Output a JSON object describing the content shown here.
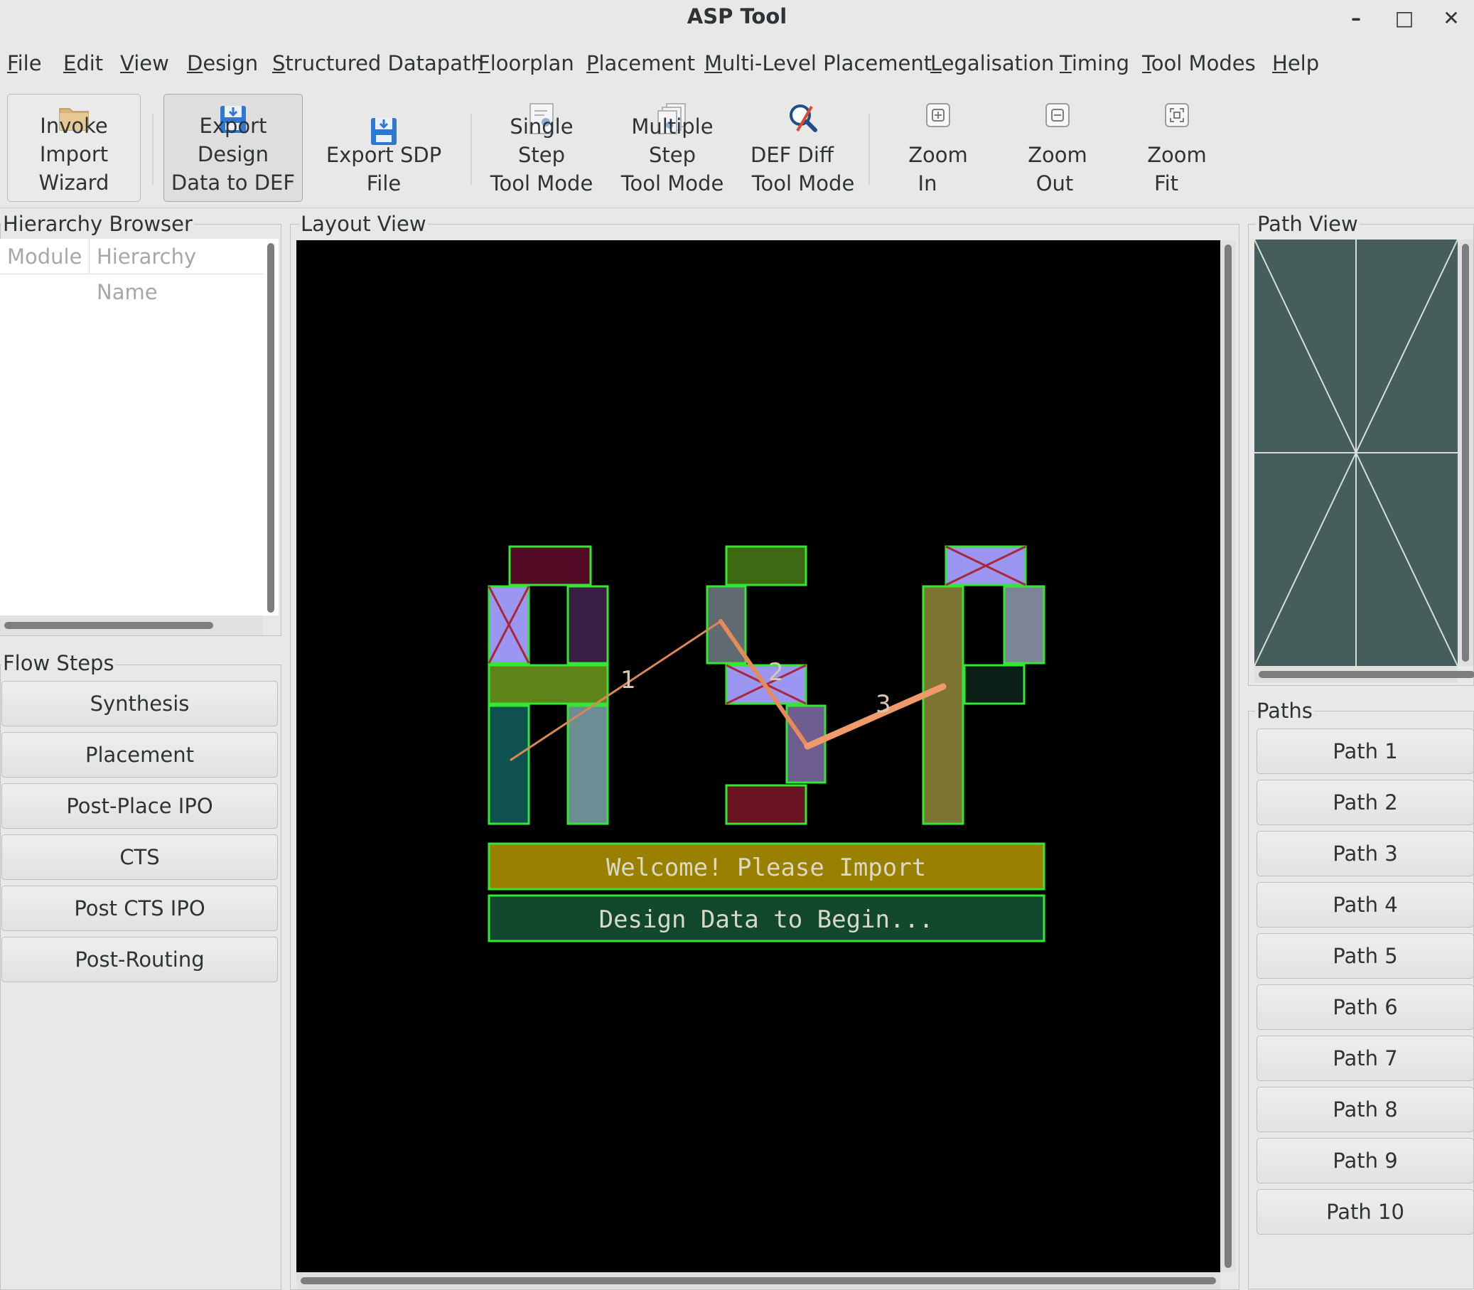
{
  "window": {
    "title": "ASP Tool",
    "minimize_glyph": "–",
    "maximize_glyph": "□",
    "close_glyph": "✕"
  },
  "menu": [
    {
      "label": "File",
      "mnemonic": "F",
      "rest": "ile"
    },
    {
      "label": "Edit",
      "mnemonic": "E",
      "rest": "dit"
    },
    {
      "label": "View",
      "mnemonic": "V",
      "rest": "iew"
    },
    {
      "label": "Design",
      "mnemonic": "D",
      "rest": "esign"
    },
    {
      "label": "Structured Datapath",
      "mnemonic": "S",
      "rest": "tructured Datapath"
    },
    {
      "label": "Floorplan",
      "mnemonic": "F",
      "rest": "loorplan"
    },
    {
      "label": "Placement",
      "mnemonic": "P",
      "rest": "lacement"
    },
    {
      "label": "Multi-Level Placement",
      "mnemonic": "M",
      "rest": "ulti-Level Placement"
    },
    {
      "label": "Legalisation",
      "mnemonic": "L",
      "rest": "egalisation"
    },
    {
      "label": "Timing",
      "mnemonic": "T",
      "rest": "iming"
    },
    {
      "label": "Tool Modes",
      "mnemonic": "T",
      "rest": "ool Modes"
    },
    {
      "label": "Help",
      "mnemonic": "H",
      "rest": "elp"
    }
  ],
  "toolbar": {
    "import": {
      "line1": "Invoke Import",
      "line2": "Wizard",
      "icon": "folder-icon"
    },
    "export_def": {
      "line1": "Export Design",
      "line2": "Data to DEF",
      "icon": "save-icon"
    },
    "export_sdp": {
      "line1": "",
      "line2": "Export SDP File",
      "icon": "save-icon"
    },
    "single_step": {
      "line1": "Single Step",
      "line2": "Tool Mode",
      "icon": "document-icon"
    },
    "multi_step": {
      "line1": "Multiple Step",
      "line2": "Tool Mode",
      "icon": "documents-icon"
    },
    "def_diff": {
      "line1": "DEF Diff",
      "line2": "Tool Mode",
      "icon": "magnifier-icon"
    },
    "zoom_in": {
      "line1": "Zoom",
      "line2": "In",
      "icon": "zoom-in-icon"
    },
    "zoom_out": {
      "line1": "Zoom",
      "line2": "Out",
      "icon": "zoom-out-icon"
    },
    "zoom_fit": {
      "line1": "Zoom",
      "line2": "Fit",
      "icon": "zoom-fit-icon"
    }
  },
  "hierarchy": {
    "title": "Hierarchy Browser",
    "columns": [
      "Module",
      "Hierarchy Name"
    ]
  },
  "flow": {
    "title": "Flow Steps",
    "steps": [
      "Synthesis",
      "Placement",
      "Post-Place IPO",
      "CTS",
      "Post CTS IPO",
      "Post-Routing"
    ]
  },
  "layout": {
    "title": "Layout View",
    "banner_line1": "Welcome! Please Import",
    "banner_line2": "Design Data to Begin...",
    "path_labels": [
      "1",
      "2",
      "3"
    ],
    "colors": {
      "background": "#000000",
      "cell_outline": "#33e733",
      "banner_top": "#9a8000",
      "banner_bottom": "#12482e",
      "path_line": "#e58a5a"
    }
  },
  "pathview": {
    "title": "Path View",
    "background": "#455e5c"
  },
  "paths": {
    "title": "Paths",
    "items": [
      "Path 1",
      "Path 2",
      "Path 3",
      "Path 4",
      "Path 5",
      "Path 6",
      "Path 7",
      "Path 8",
      "Path 9",
      "Path 10"
    ]
  }
}
